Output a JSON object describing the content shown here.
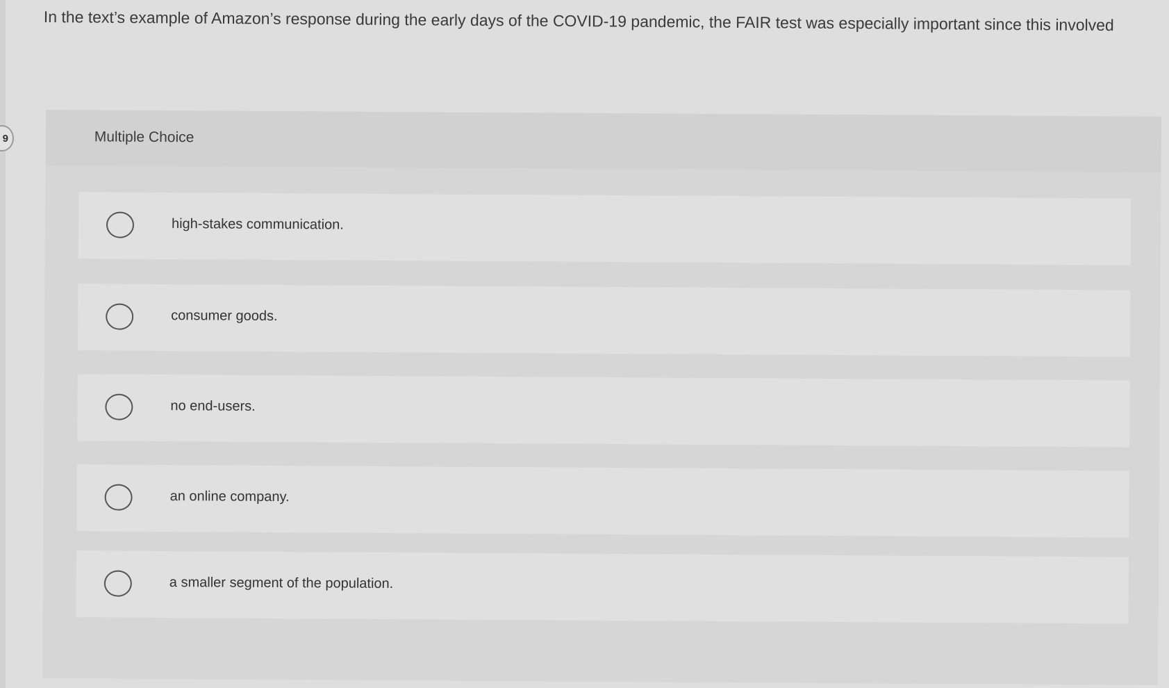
{
  "side_badge": "9",
  "question": {
    "text": "In the text’s example of Amazon’s response during the early days of the COVID-19 pandemic, the FAIR test was especially important since this involved"
  },
  "choice": {
    "header": "Multiple Choice",
    "options": [
      {
        "label": "high-stakes communication."
      },
      {
        "label": "consumer goods."
      },
      {
        "label": "no end-users."
      },
      {
        "label": "an online company."
      },
      {
        "label": "a smaller segment of the population."
      }
    ],
    "selected": null
  },
  "colors": {
    "background": "#dedede",
    "panel": "#d6d6d6",
    "option": "#e0e0e0",
    "text": "#3a3a3a"
  }
}
